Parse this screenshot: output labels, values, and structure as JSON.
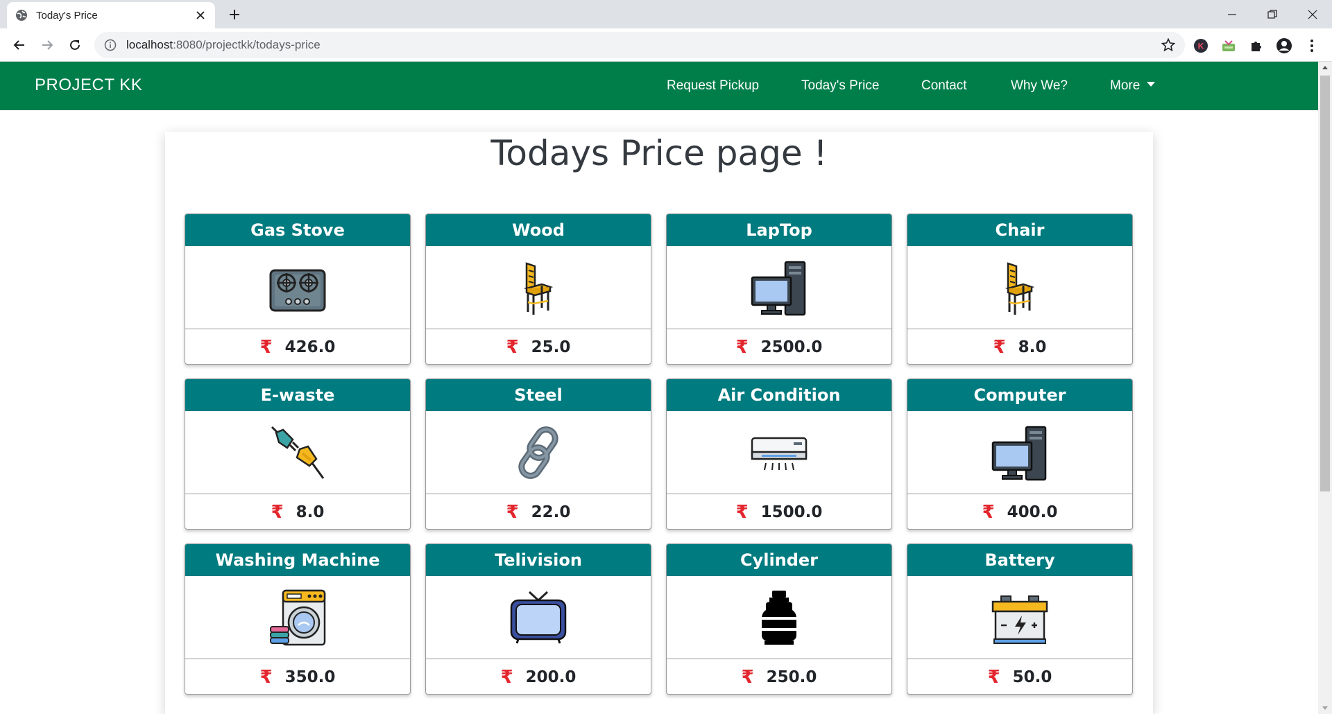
{
  "browser": {
    "tab_title": "Today's Price",
    "url_host": "localhost",
    "url_rest": ":8080/projectkk/todays-price"
  },
  "navbar": {
    "brand": "PROJECT KK",
    "links": [
      "Request Pickup",
      "Today's Price",
      "Contact",
      "Why We?",
      "More"
    ]
  },
  "page": {
    "title": "Todays Price page !"
  },
  "currency_symbol": "₹",
  "items": [
    {
      "name": "Gas Stove",
      "price": "426.0",
      "icon": "gas-stove-icon"
    },
    {
      "name": "Wood",
      "price": "25.0",
      "icon": "chair-icon"
    },
    {
      "name": "LapTop",
      "price": "2500.0",
      "icon": "computer-icon"
    },
    {
      "name": "Chair",
      "price": "8.0",
      "icon": "chair-icon"
    },
    {
      "name": "E-waste",
      "price": "8.0",
      "icon": "plug-icon"
    },
    {
      "name": "Steel",
      "price": "22.0",
      "icon": "chain-link-icon"
    },
    {
      "name": "Air Condition",
      "price": "1500.0",
      "icon": "air-conditioner-icon"
    },
    {
      "name": "Computer",
      "price": "400.0",
      "icon": "computer-icon"
    },
    {
      "name": "Washing Machine",
      "price": "350.0",
      "icon": "washing-machine-icon"
    },
    {
      "name": "Telivision",
      "price": "200.0",
      "icon": "television-icon"
    },
    {
      "name": "Cylinder",
      "price": "250.0",
      "icon": "gas-cylinder-icon"
    },
    {
      "name": "Battery",
      "price": "50.0",
      "icon": "battery-icon"
    }
  ],
  "colors": {
    "navbar": "#007e4a",
    "card_header": "#007b7f",
    "rupee": "#e3262e"
  }
}
